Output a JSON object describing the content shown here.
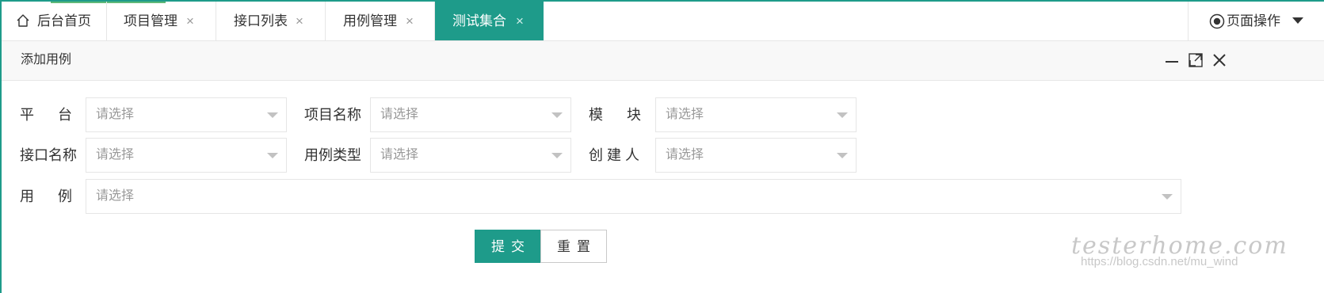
{
  "tabs": [
    {
      "label": "后台首页",
      "icon": "home-icon"
    },
    {
      "label": "项目管理",
      "close": "×"
    },
    {
      "label": "接口列表",
      "close": "×"
    },
    {
      "label": "用例管理",
      "close": "×"
    },
    {
      "label": "测试集合",
      "close": "×",
      "active": true
    }
  ],
  "page_ops": {
    "label": "页面操作",
    "icon": "radio-icon"
  },
  "panel": {
    "title": "添加用例",
    "controls": [
      "minimize-icon",
      "maximize-icon",
      "close-icon"
    ]
  },
  "form": {
    "fields": [
      {
        "label": "平      台",
        "placeholder": "请选择"
      },
      {
        "label": "项目名称",
        "placeholder": "请选择"
      },
      {
        "label": "模      块",
        "placeholder": "请选择"
      },
      {
        "label": "接口名称",
        "placeholder": "请选择"
      },
      {
        "label": "用例类型",
        "placeholder": "请选择"
      },
      {
        "label": "创 建 人",
        "placeholder": "请选择"
      },
      {
        "label": "用      例",
        "placeholder": "请选择"
      }
    ],
    "submit_label": "提交",
    "reset_label": "重置"
  },
  "watermark": {
    "brand": "testerhome.com",
    "url": "https://blog.csdn.net/mu_wind"
  },
  "colors": {
    "accent": "#1e9b8a",
    "accent_green": "#5fb878",
    "border": "#e6e6e6",
    "placeholder": "#999999"
  }
}
